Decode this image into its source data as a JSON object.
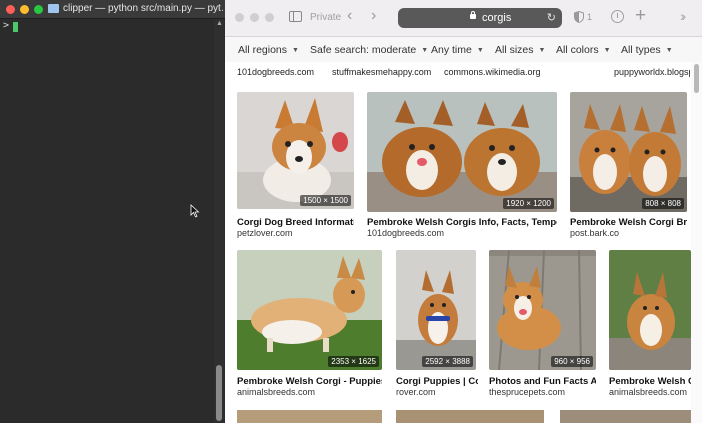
{
  "terminal": {
    "title": "clipper — python src/main.py — pyt…",
    "prompt": ">"
  },
  "browser": {
    "private_label": "Private",
    "url": "corgis",
    "tracker_count": "1",
    "filters": [
      {
        "label": "All regions"
      },
      {
        "label": "Safe search: moderate"
      },
      {
        "label": "Any time"
      },
      {
        "label": "All sizes"
      },
      {
        "label": "All colors"
      },
      {
        "label": "All types"
      }
    ],
    "top_row_sources": [
      "101dogbreeds.com",
      "stuffmakesmehappy.com",
      "commons.wikimedia.org",
      "puppyworldx.blogsp"
    ],
    "row1": [
      {
        "title": "Corgi Dog Breed Informatio…",
        "site": "petzlover.com",
        "dims": "1500 × 1500"
      },
      {
        "title": "Pembroke Welsh Corgis Info, Facts, Temperam…",
        "site": "101dogbreeds.com",
        "dims": "1920 × 1200"
      },
      {
        "title": "Pembroke Welsh Corgi Bree…",
        "site": "post.bark.co",
        "dims": "808 × 808"
      }
    ],
    "row2": [
      {
        "title": "Pembroke Welsh Corgi - Puppies, R…",
        "site": "animalsbreeds.com",
        "dims": "2353 × 1625"
      },
      {
        "title": "Corgi Puppies | Co…",
        "site": "rover.com",
        "dims": "2592 × 3888"
      },
      {
        "title": "Photos and Fun Facts Ab…",
        "site": "thesprucepets.com",
        "dims": "960 × 956"
      },
      {
        "title": "Pembroke Welsh Co",
        "site": "animalsbreeds.com",
        "dims": ""
      }
    ],
    "colors": {
      "accent": "#595959",
      "toolbar": "#f0eef0",
      "terminal_bg": "#2b2b2b"
    }
  }
}
